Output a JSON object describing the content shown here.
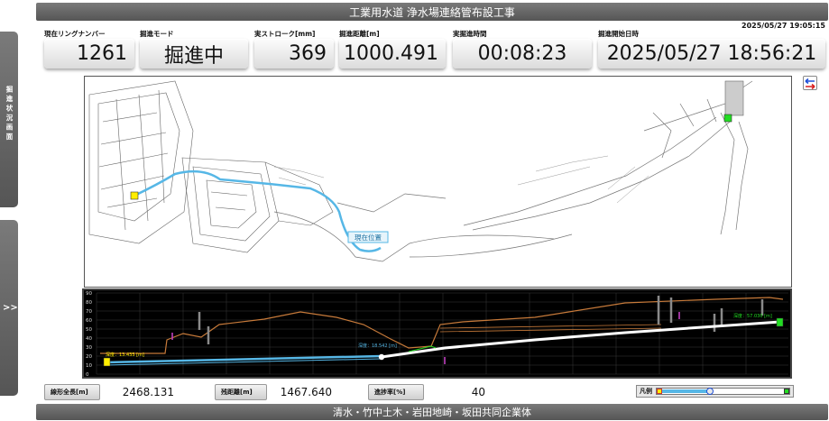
{
  "header": {
    "title": "工業用水道 浄水場連絡管布設工事",
    "clock": "2025/05/27 19:05:15"
  },
  "metrics": [
    {
      "label": "現在リングナンバー",
      "value": "1261"
    },
    {
      "label": "掘進モード",
      "value": "掘進中"
    },
    {
      "label": "実ストローク[mm]",
      "value": "369"
    },
    {
      "label": "掘進距離[m]",
      "value": "1000.491"
    },
    {
      "label": "実掘進時間",
      "value": "00:08:23"
    },
    {
      "label": "掘進開始日時",
      "value": "2025/05/27 18:56:21"
    }
  ],
  "sidebar": {
    "top_label": "掘進状況画面",
    "bottom_label": ">>"
  },
  "map": {
    "current_position_label": "現在位置"
  },
  "profile": {
    "y_ticks": [
      "90",
      "80",
      "70",
      "60",
      "50",
      "40",
      "30",
      "20",
      "10",
      "0"
    ],
    "start_label": "深度：13.435 [m]",
    "current_label": "深度：18.542 [m]",
    "end_label": "深度：57.030 [m]"
  },
  "stats": {
    "total_label": "線形全長[m]",
    "total_value": "2468.131",
    "remaining_label": "残距離[m]",
    "remaining_value": "1467.640",
    "progress_label": "進捗率[%]",
    "progress_value": "40",
    "progress_fraction": 0.4
  },
  "legend": {
    "label": "凡例"
  },
  "footer": {
    "text": "清水・竹中土木・岩田地崎・坂田共同企業体"
  },
  "colors": {
    "accent": "#56b7e6",
    "start": "#ffee00",
    "end": "#22dd22",
    "line": "#ffffff",
    "ground": "#c77a3a"
  }
}
